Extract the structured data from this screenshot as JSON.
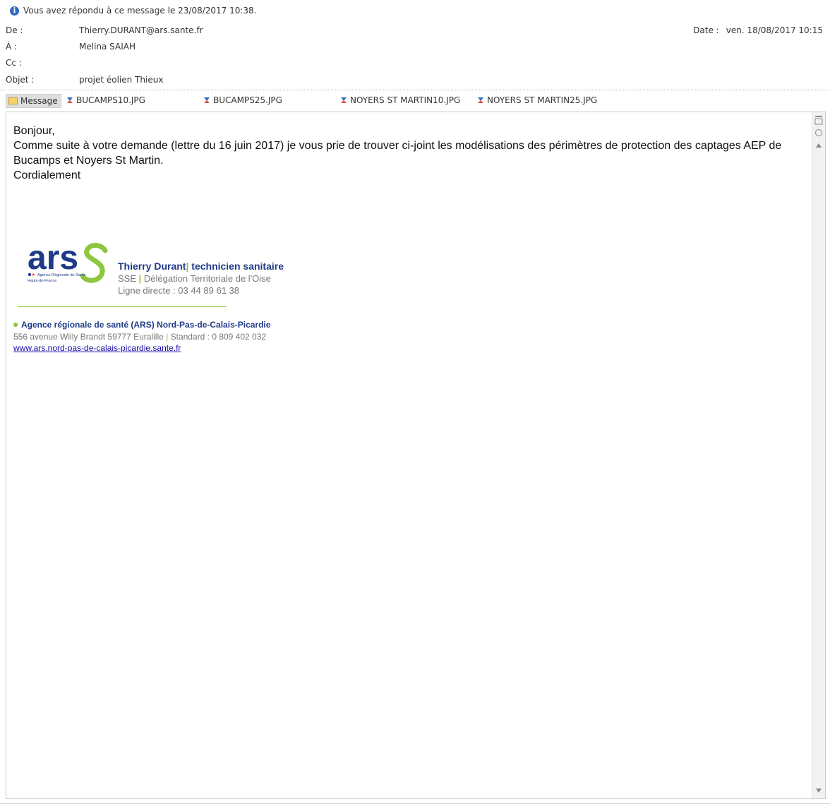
{
  "info_bar": {
    "text": "Vous avez répondu à ce message le 23/08/2017 10:38."
  },
  "header": {
    "from_label": "De :",
    "from_value": "Thierry.DURANT@ars.sante.fr",
    "to_label": "À :",
    "to_value": "Melina SAIAH",
    "cc_label": "Cc :",
    "cc_value": "",
    "subject_label": "Objet :",
    "subject_value": "projet éolien Thieux",
    "date_label": "Date :",
    "date_value": "ven. 18/08/2017 10:15"
  },
  "attachments": {
    "message_tab": "Message",
    "files": [
      "BUCAMPS10.JPG",
      "BUCAMPS25.JPG",
      "NOYERS ST MARTIN10.JPG",
      "NOYERS ST MARTIN25.JPG"
    ]
  },
  "body": {
    "greeting": "Bonjour,",
    "paragraph": "Comme suite à votre demande (lettre du 16 juin 2017) je vous prie de trouver ci-joint les modélisations des périmètres de protection des captages AEP de Bucamps et Noyers St Martin.",
    "closing": "Cordialement"
  },
  "signature": {
    "logo_text": "ars",
    "logo_sub1": "Agence Régionale de Santé",
    "logo_sub2": "Hauts-de-France",
    "name": "Thierry Durant",
    "title": "technicien sanitaire",
    "dept": "SSE",
    "delegation": "Délégation Territoriale de l'Oise",
    "phone": "Ligne directe : 03 44 89 61 38",
    "org": "Agence régionale de santé (ARS) Nord-Pas-de-Calais-Picardie",
    "address": "556 avenue Willy Brandt 59777 Euralille",
    "standard": "Standard : 0 809 402 032",
    "url": "www.ars.nord-pas-de-calais-picardie.sante.fr"
  },
  "colors": {
    "brand_blue": "#1f3a87",
    "brand_green": "#8dc63f",
    "link": "#1a0dab"
  }
}
